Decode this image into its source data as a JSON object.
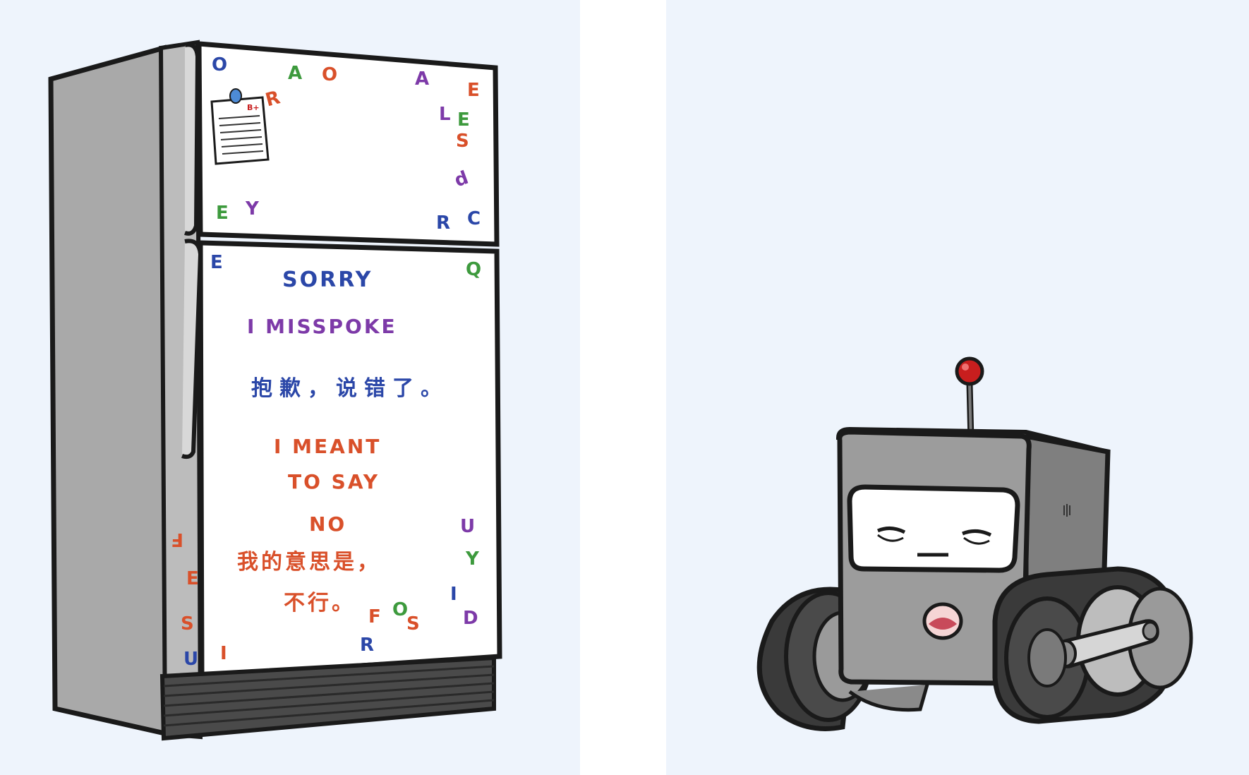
{
  "colors": {
    "background": "#eef4fc",
    "outline": "#1a1a1a",
    "fridge_body": "#a9a9a9",
    "fridge_door": "#ffffff",
    "magnet_blue": "#2b47a8",
    "magnet_red": "#d9502a",
    "magnet_green": "#3d9a3d",
    "magnet_purple": "#7d3aa8",
    "robot_body": "#9c9c9c",
    "robot_antenna_ball": "#c81e1e"
  },
  "fridge": {
    "top_door": {
      "note_label": "B+",
      "letters": [
        {
          "text": "O",
          "color": "#2b47a8"
        },
        {
          "text": "R",
          "color": "#d9502a"
        },
        {
          "text": "A",
          "color": "#3d9a3d"
        },
        {
          "text": "O",
          "color": "#d9502a"
        },
        {
          "text": "A",
          "color": "#7d3aa8"
        },
        {
          "text": "E",
          "color": "#d9502a"
        },
        {
          "text": "L",
          "color": "#7d3aa8"
        },
        {
          "text": "E",
          "color": "#3d9a3d"
        },
        {
          "text": "S",
          "color": "#d9502a"
        },
        {
          "text": "d",
          "color": "#7d3aa8"
        },
        {
          "text": "E",
          "color": "#3d9a3d"
        },
        {
          "text": "Y",
          "color": "#7d3aa8"
        },
        {
          "text": "R",
          "color": "#2b47a8"
        },
        {
          "text": "C",
          "color": "#2b47a8"
        }
      ]
    },
    "bottom_door": {
      "message": {
        "line1": "SORRY",
        "line2": "I MISSPOKE",
        "line3_cn": "抱歉，说错了。",
        "line4": "I MEANT",
        "line5": "TO SAY",
        "line6": "NO",
        "line7_cn": "我的意思是，",
        "line8_cn": "不行。"
      },
      "stray_letters": [
        {
          "text": "E",
          "color": "#2b47a8"
        },
        {
          "text": "Q",
          "color": "#3d9a3d"
        },
        {
          "text": "F",
          "color": "#d9502a"
        },
        {
          "text": "U",
          "color": "#7d3aa8"
        },
        {
          "text": "Y",
          "color": "#3d9a3d"
        },
        {
          "text": "E",
          "color": "#d9502a"
        },
        {
          "text": "I",
          "color": "#2b47a8"
        },
        {
          "text": "D",
          "color": "#7d3aa8"
        },
        {
          "text": "S",
          "color": "#d9502a"
        },
        {
          "text": "F",
          "color": "#d9502a"
        },
        {
          "text": "O",
          "color": "#3d9a3d"
        },
        {
          "text": "S",
          "color": "#d9502a"
        },
        {
          "text": "R",
          "color": "#2b47a8"
        },
        {
          "text": "U",
          "color": "#2b47a8"
        },
        {
          "text": "I",
          "color": "#d9502a"
        }
      ]
    }
  },
  "robot": {
    "expression": "sad-sleepy"
  }
}
